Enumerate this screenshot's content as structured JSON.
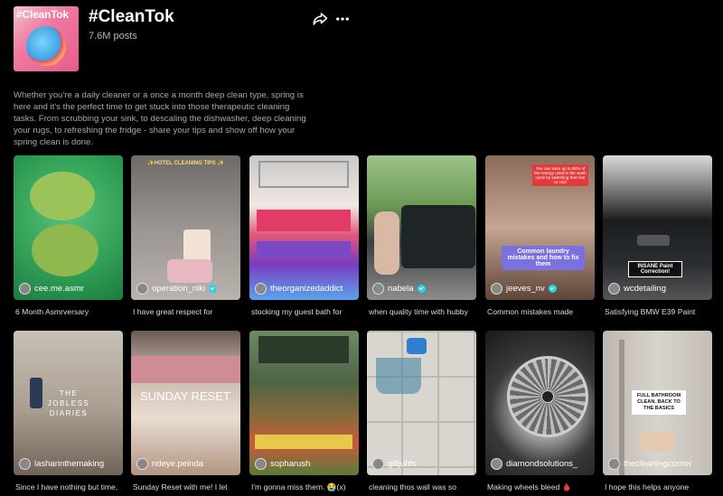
{
  "header": {
    "cover_tag": "#CleanTok",
    "title": "#CleanTok",
    "posts": "7.6M posts",
    "icons": [
      "share-icon",
      "more-icon"
    ]
  },
  "description": "Whether you're a daily cleaner or a once a month deep clean type, spring is here and it's the perfect time to get stuck into those therapeutic cleaning tasks. From scrubbing your sink, to descaling the dishwasher, deep cleaning your rugs, to refreshing the fridge - share your tips and show off how your spring clean is done.",
  "videos": [
    {
      "user": "cee.me.asmr",
      "caption": "6 Month Asmrversary",
      "verified": false
    },
    {
      "user": "operation_niki",
      "caption": "I have great respect for",
      "verified": true,
      "overlay": "✨HOTEL CLEANING TIPS ✨"
    },
    {
      "user": "theorganizedaddict",
      "caption": "stocking my guest bath for",
      "verified": false
    },
    {
      "user": "nabela",
      "caption": "when quality time with hubby",
      "verified": true
    },
    {
      "user": "jeeves_nv",
      "caption": "Common mistakes made",
      "verified": true,
      "overlay": "Common laundry mistakes and how to fix them",
      "overlay_top": "You can save up to 90% of the energy used in the wash cycle by switching from hot to cold"
    },
    {
      "user": "wcdetailing",
      "caption": "Satisfying BMW E39 Paint",
      "verified": false,
      "overlay": "INSANE Paint Correction!"
    },
    {
      "user": "lasharinthemaking",
      "caption": "Since I have nothing but time,",
      "verified": false,
      "overlay": "THE JOBLESS DIARIES"
    },
    {
      "user": "ndeye.peinda",
      "caption": "Sunday Reset with me! I let",
      "verified": false,
      "overlay": "SUNDAY RESET"
    },
    {
      "user": "sopharush",
      "caption": "I'm gonna miss them. 😭(x)",
      "verified": false
    },
    {
      "user": "gilljuhfs",
      "caption": "cleaning thos wall was so",
      "verified": false
    },
    {
      "user": "diamondsolutions_",
      "caption": "Making wheels bleed 🩸",
      "verified": false
    },
    {
      "user": "thecleaningcorner",
      "caption": "I hope this helps anyone",
      "verified": false,
      "overlay": "FULL BATHROOM CLEAN. BACK TO THE BASICS"
    }
  ]
}
